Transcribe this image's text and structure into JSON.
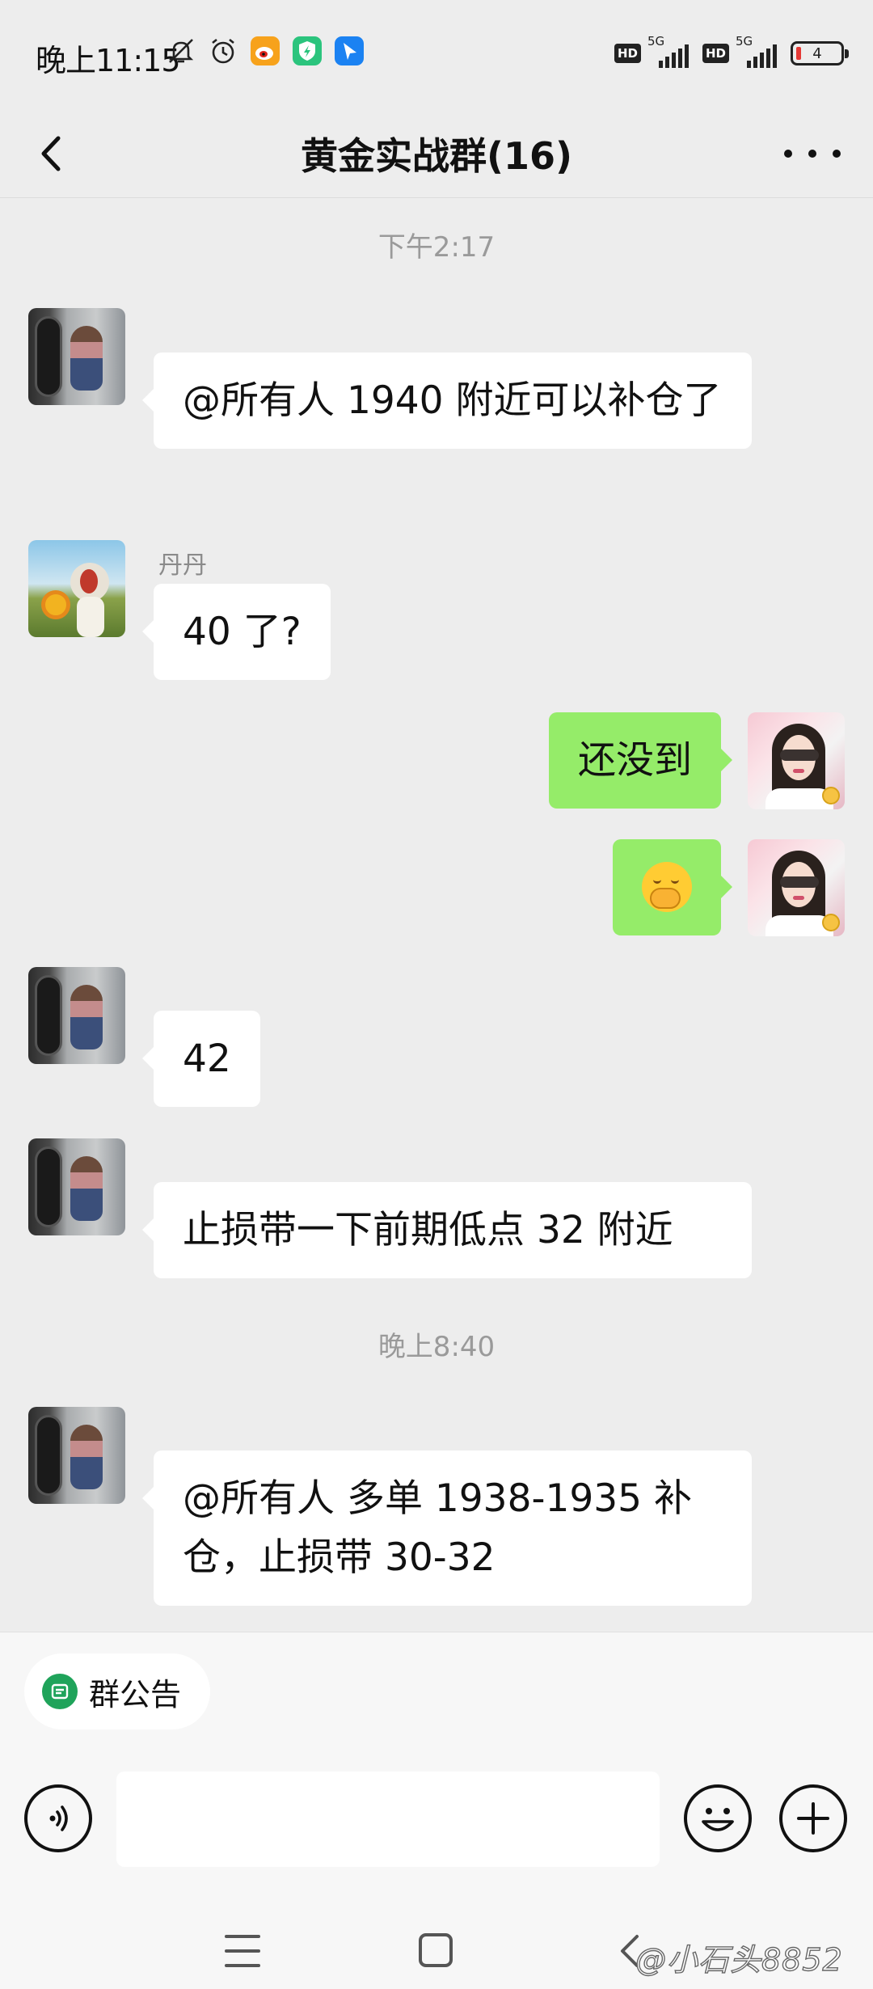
{
  "status_bar": {
    "time": "晚上11:15",
    "battery": "4",
    "network": "5G",
    "hd_label": "HD",
    "icons": [
      "mute-icon",
      "alarm-icon",
      "weibo-icon",
      "security-app-icon",
      "feishu-icon",
      "hd-icon",
      "signal-icon",
      "battery-icon"
    ]
  },
  "header": {
    "title": "黄金实战群(16)",
    "back_icon": "chevron-left-icon",
    "more_icon": "more-dots-icon"
  },
  "messages": [
    {
      "type": "timestamp",
      "text": "下午2:17"
    },
    {
      "type": "message",
      "side": "left",
      "sender": "",
      "text": "@所有人  1940 附近可以补仓了"
    },
    {
      "type": "message",
      "side": "left",
      "sender": "丹丹",
      "text": "40 了?"
    },
    {
      "type": "message",
      "side": "right",
      "sender": "",
      "text": "还没到"
    },
    {
      "type": "message",
      "side": "right",
      "sender": "",
      "emoji": "shy-face-emoji"
    },
    {
      "type": "message",
      "side": "left",
      "sender": "",
      "text": "42"
    },
    {
      "type": "message",
      "side": "left",
      "sender": "",
      "text": "止损带一下前期低点 32 附近"
    },
    {
      "type": "timestamp",
      "text": "晚上8:40"
    },
    {
      "type": "message",
      "side": "left",
      "sender": "",
      "text": "@所有人   多单 1938-1935 补仓，止损带 30-32"
    }
  ],
  "bottom": {
    "notice_label": "群公告",
    "input_value": "",
    "voice_icon": "voice-icon",
    "emoji_icon": "smiley-icon",
    "plus_icon": "plus-icon"
  },
  "nav": {
    "icons": [
      "menu-icon",
      "home-square-icon",
      "back-triangle-icon"
    ]
  },
  "watermark": "@小石头8852",
  "colors": {
    "background": "#ededed",
    "my_bubble": "#95ec69",
    "other_bubble": "#ffffff",
    "notice_icon": "#1fa35a"
  }
}
